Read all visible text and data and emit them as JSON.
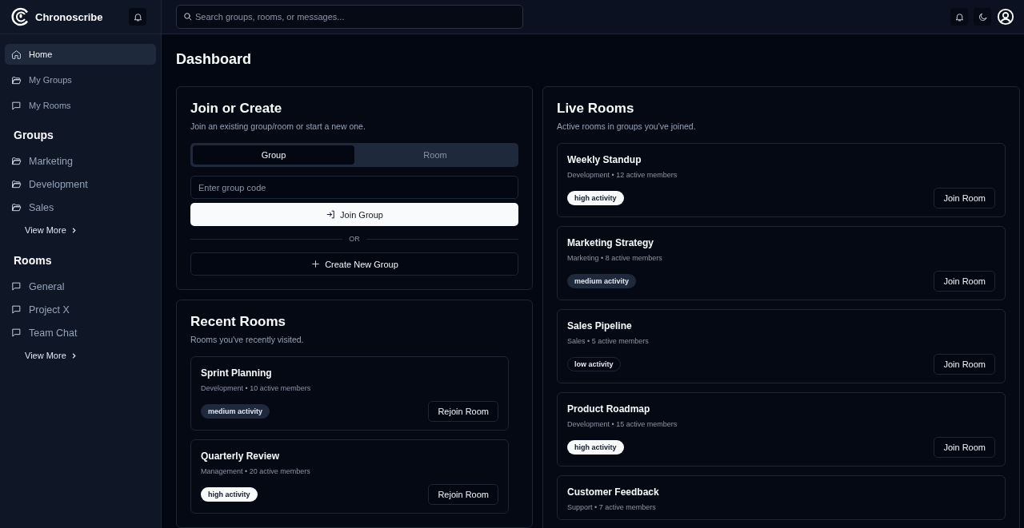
{
  "app": {
    "name": "Chronoscribe"
  },
  "search": {
    "placeholder": "Search groups, rooms, or messages..."
  },
  "nav": [
    {
      "label": "Home",
      "kind": "home",
      "selected": true
    },
    {
      "label": "My Groups",
      "kind": "folder",
      "selected": false
    },
    {
      "label": "My Rooms",
      "kind": "chat",
      "selected": false
    }
  ],
  "sections": [
    {
      "title": "Groups",
      "kind": "folder",
      "items": [
        "Marketing",
        "Development",
        "Sales"
      ],
      "more": "View More"
    },
    {
      "title": "Rooms",
      "kind": "chat",
      "items": [
        "General",
        "Project X",
        "Team Chat"
      ],
      "more": "View More"
    }
  ],
  "page_title": "Dashboard",
  "join": {
    "title": "Join or Create",
    "subtitle": "Join an existing group/room or start a new one.",
    "tabs": [
      {
        "label": "Group",
        "selected": true
      },
      {
        "label": "Room",
        "selected": false
      }
    ],
    "placeholder": "Enter group code",
    "join_button": "Join Group",
    "divider": "OR",
    "create_button": "Create New Group"
  },
  "recent": {
    "title": "Recent Rooms",
    "subtitle": "Rooms you've recently visited.",
    "rooms": [
      {
        "name": "Sprint Planning",
        "meta": "Development • 10 active members",
        "badge": "medium activity",
        "kind": "medium",
        "button": "Rejoin Room"
      },
      {
        "name": "Quarterly Review",
        "meta": "Management • 20 active members",
        "badge": "high activity",
        "kind": "high",
        "button": "Rejoin Room"
      }
    ]
  },
  "live": {
    "title": "Live Rooms",
    "subtitle": "Active rooms in groups you've joined.",
    "rooms": [
      {
        "name": "Weekly Standup",
        "meta": "Development • 12 active members",
        "badge": "high activity",
        "kind": "high",
        "button": "Join Room"
      },
      {
        "name": "Marketing Strategy",
        "meta": "Marketing • 8 active members",
        "badge": "medium activity",
        "kind": "medium",
        "button": "Join Room"
      },
      {
        "name": "Sales Pipeline",
        "meta": "Sales • 5 active members",
        "badge": "low activity",
        "kind": "low",
        "button": "Join Room"
      },
      {
        "name": "Product Roadmap",
        "meta": "Development • 15 active members",
        "badge": "high activity",
        "kind": "high",
        "button": "Join Room"
      },
      {
        "name": "Customer Feedback",
        "meta": "Support • 7 active members"
      }
    ]
  }
}
